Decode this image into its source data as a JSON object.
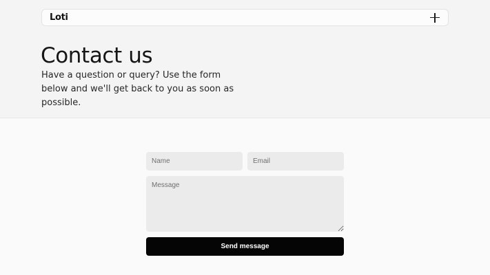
{
  "header": {
    "brand": "Loti",
    "menu_icon": "plus-icon"
  },
  "hero": {
    "title": "Contact us",
    "subtitle": "Have a question or query? Use the form below and we'll get back to you as soon as possible."
  },
  "form": {
    "name_placeholder": "Name",
    "email_placeholder": "Email",
    "message_placeholder": "Message",
    "submit_label": "Send message"
  },
  "colors": {
    "hero_background": "#f4f4f4",
    "page_background": "#fafafa",
    "field_background": "#ebebeb",
    "button_background": "#050505"
  }
}
